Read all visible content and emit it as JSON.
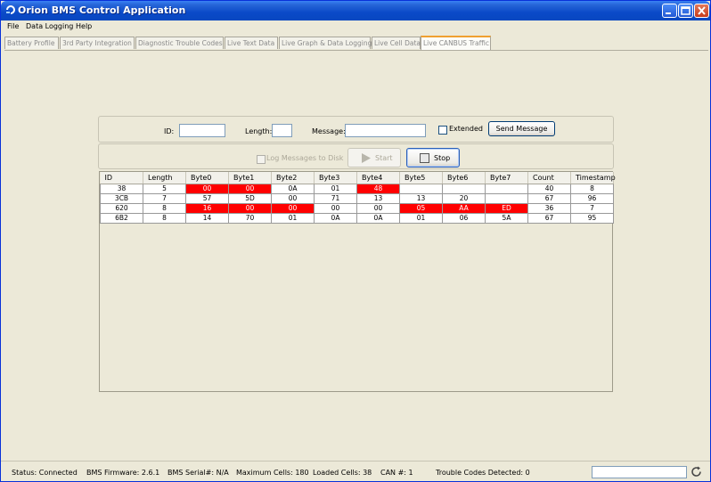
{
  "window": {
    "title": "Orion BMS Control Application"
  },
  "menu": [
    "File",
    "Data Logging",
    "Help"
  ],
  "tabs": [
    "Battery Profile",
    "3rd Party Integration",
    "Diagnostic Trouble Codes",
    "Live Text Data",
    "Live Graph & Data Logging",
    "Live Cell Data",
    "Live CANBUS Traffic"
  ],
  "active_tab": "Live CANBUS Traffic",
  "send_form": {
    "id_label": "ID:",
    "id_value": "",
    "length_label": "Length:",
    "length_value": "",
    "message_label": "Message:",
    "message_value": "",
    "extended_label": "Extended",
    "extended_checked": false,
    "send_label": "Send Message"
  },
  "controls": {
    "log_label": "Log Messages to Disk",
    "log_checked": false,
    "start_label": "Start",
    "stop_label": "Stop"
  },
  "table": {
    "columns": [
      "ID",
      "Length",
      "Byte0",
      "Byte1",
      "Byte2",
      "Byte3",
      "Byte4",
      "Byte5",
      "Byte6",
      "Byte7",
      "Count",
      "Timestamp"
    ],
    "rows": [
      [
        "38",
        "5",
        "00",
        "00",
        "0A",
        "01",
        "48",
        "",
        "",
        "",
        "40",
        "8"
      ],
      [
        "3CB",
        "7",
        "57",
        "5D",
        "00",
        "71",
        "13",
        "13",
        "20",
        "",
        "67",
        "96"
      ],
      [
        "620",
        "8",
        "16",
        "00",
        "00",
        "00",
        "00",
        "05",
        "AA",
        "ED",
        "36",
        "7"
      ],
      [
        "6B2",
        "8",
        "14",
        "70",
        "01",
        "0A",
        "0A",
        "01",
        "06",
        "5A",
        "67",
        "95"
      ]
    ],
    "highlighted": [
      [
        0,
        2
      ],
      [
        0,
        3
      ],
      [
        0,
        6
      ],
      [
        2,
        2
      ],
      [
        2,
        3
      ],
      [
        2,
        4
      ],
      [
        2,
        7
      ],
      [
        2,
        8
      ],
      [
        2,
        9
      ]
    ],
    "highlight_color": "#ff0000"
  },
  "status": {
    "status": "Status: Connected",
    "firmware": "BMS Firmware: 2.6.1",
    "serial": "BMS Serial#: N/A",
    "max_cells": "Maximum Cells: 180",
    "loaded_cells": "Loaded Cells: 38",
    "can": "CAN #: 1",
    "trouble": "Trouble Codes Detected: 0"
  },
  "colors": {
    "titlebar": "#0a49c8",
    "window_bg": "#ece9d8",
    "active_tab_accent": "#f0a030"
  }
}
